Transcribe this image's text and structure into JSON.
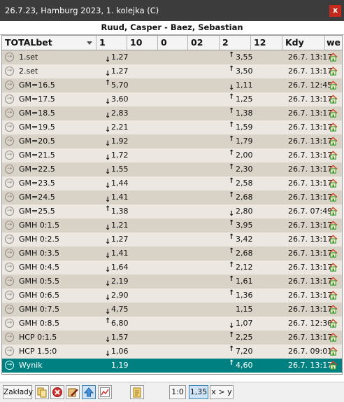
{
  "window": {
    "title": "26.7.23, Hamburg 2023, 1. kolejka (C)",
    "close_glyph": "x"
  },
  "match_title": "Ruud, Casper - Baez, Sebastian",
  "columns": [
    "TOTALbet",
    "1",
    "10",
    "0",
    "02",
    "2",
    "12",
    "Kdy",
    "we"
  ],
  "rows": [
    {
      "label": "1.set",
      "v1": "1,27",
      "d1": "down",
      "v2": "3,55",
      "d2": "up",
      "time": "26.7. 13:17"
    },
    {
      "label": "2.set",
      "v1": "1,27",
      "d1": "down",
      "v2": "3,50",
      "d2": "up",
      "time": "26.7. 13:17"
    },
    {
      "label": "GM=16.5",
      "v1": "5,70",
      "d1": "up",
      "v2": "1,11",
      "d2": "down",
      "time": "26.7. 12:45"
    },
    {
      "label": "GM=17.5",
      "v1": "3,60",
      "d1": "down",
      "v2": "1,25",
      "d2": "up",
      "time": "26.7. 13:17"
    },
    {
      "label": "GM=18.5",
      "v1": "2,83",
      "d1": "down",
      "v2": "1,38",
      "d2": "up",
      "time": "26.7. 13:17"
    },
    {
      "label": "GM=19.5",
      "v1": "2,21",
      "d1": "down",
      "v2": "1,59",
      "d2": "up",
      "time": "26.7. 13:17"
    },
    {
      "label": "GM=20.5",
      "v1": "1,92",
      "d1": "down",
      "v2": "1,79",
      "d2": "up",
      "time": "26.7. 13:17"
    },
    {
      "label": "GM=21.5",
      "v1": "1,72",
      "d1": "down",
      "v2": "2,00",
      "d2": "up",
      "time": "26.7. 13:17"
    },
    {
      "label": "GM=22.5",
      "v1": "1,55",
      "d1": "down",
      "v2": "2,30",
      "d2": "up",
      "time": "26.7. 13:17"
    },
    {
      "label": "GM=23.5",
      "v1": "1,44",
      "d1": "down",
      "v2": "2,58",
      "d2": "up",
      "time": "26.7. 13:17"
    },
    {
      "label": "GM=24.5",
      "v1": "1,41",
      "d1": "down",
      "v2": "2,68",
      "d2": "up",
      "time": "26.7. 13:17"
    },
    {
      "label": "GM=25.5",
      "v1": "1,38",
      "d1": "up",
      "v2": "2,80",
      "d2": "down",
      "time": "26.7. 07:49"
    },
    {
      "label": "GMH 0:1.5",
      "v1": "1,21",
      "d1": "down",
      "v2": "3,95",
      "d2": "up",
      "time": "26.7. 13:17"
    },
    {
      "label": "GMH 0:2.5",
      "v1": "1,27",
      "d1": "down",
      "v2": "3,42",
      "d2": "up",
      "time": "26.7. 13:17"
    },
    {
      "label": "GMH 0:3.5",
      "v1": "1,41",
      "d1": "down",
      "v2": "2,68",
      "d2": "up",
      "time": "26.7. 13:17"
    },
    {
      "label": "GMH 0:4.5",
      "v1": "1,64",
      "d1": "down",
      "v2": "2,12",
      "d2": "up",
      "time": "26.7. 13:17"
    },
    {
      "label": "GMH 0:5.5",
      "v1": "2,19",
      "d1": "down",
      "v2": "1,61",
      "d2": "up",
      "time": "26.7. 13:17"
    },
    {
      "label": "GMH 0:6.5",
      "v1": "2,90",
      "d1": "down",
      "v2": "1,36",
      "d2": "up",
      "time": "26.7. 13:17"
    },
    {
      "label": "GMH 0:7.5",
      "v1": "4,75",
      "d1": "down",
      "v2": "1,15",
      "d2": "",
      "time": "26.7. 13:17"
    },
    {
      "label": "GMH 0:8.5",
      "v1": "6,80",
      "d1": "up",
      "v2": "1,07",
      "d2": "down",
      "time": "26.7. 12:30"
    },
    {
      "label": "HCP 0:1.5",
      "v1": "1,57",
      "d1": "down",
      "v2": "2,25",
      "d2": "up",
      "time": "26.7. 13:17"
    },
    {
      "label": "HCP 1.5:0",
      "v1": "1,06",
      "d1": "down",
      "v2": "7,20",
      "d2": "up",
      "time": "26.7. 09:01"
    },
    {
      "label": "Wynik",
      "v1": "1,19",
      "d1": "",
      "v2": "4,60",
      "d2": "up",
      "time": "26.7. 13:17",
      "selected": true
    }
  ],
  "toolbar": {
    "zaklady": "Zakłady",
    "score": "1:0",
    "odds": "1,35",
    "compare": "x > y"
  },
  "colors": {
    "row_odd": "#d9d3c7",
    "row_even": "#ece8e1",
    "selected": "#008080",
    "house_green": "#3a9a3a",
    "house_roof": "#d24a2a"
  }
}
